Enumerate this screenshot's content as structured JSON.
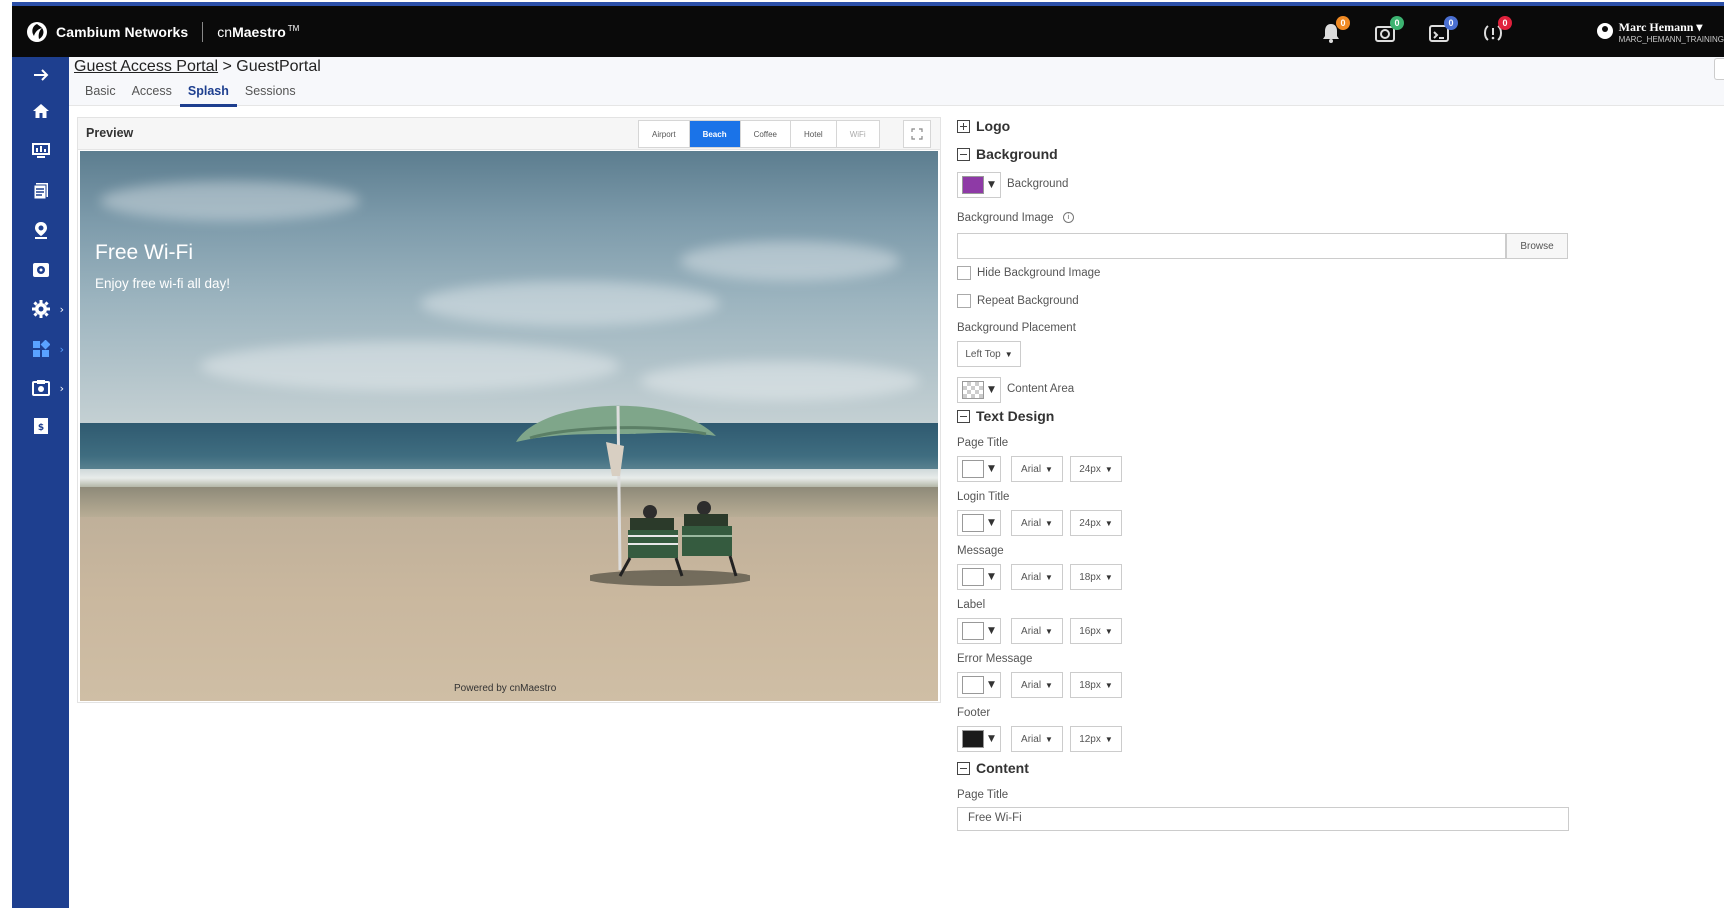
{
  "header": {
    "brand_name": "Cambium Networks",
    "product_prefix": "cn",
    "product_name": "Maestro",
    "product_mark": "TM",
    "notifications": [
      {
        "icon": "bell-icon",
        "count": "0",
        "color": "#f08a24"
      },
      {
        "icon": "device-alarm-icon",
        "count": "0",
        "color": "#3cb371"
      },
      {
        "icon": "event-icon",
        "count": "0",
        "color": "#4a6fd1"
      },
      {
        "icon": "alert-icon",
        "count": "0",
        "color": "#e0213c"
      }
    ],
    "user_name": "Marc Hemann ▾",
    "user_org": "MARC_HEMANN_TRAINING"
  },
  "sidebar": {
    "items": [
      {
        "icon": "arrow-right-icon"
      },
      {
        "icon": "home-icon"
      },
      {
        "icon": "monitor-icon"
      },
      {
        "icon": "reports-icon"
      },
      {
        "icon": "location-pin-icon"
      },
      {
        "icon": "onboard-icon"
      },
      {
        "icon": "gear-icon",
        "has_submenu": true
      },
      {
        "icon": "apps-icon",
        "has_submenu": true,
        "active": true
      },
      {
        "icon": "tools-icon",
        "has_submenu": true
      },
      {
        "icon": "document-icon"
      }
    ]
  },
  "breadcrumb": {
    "parent": "Guest Access Portal",
    "separator": " > ",
    "current": "GuestPortal"
  },
  "tabs": [
    {
      "label": "Basic",
      "active": false
    },
    {
      "label": "Access",
      "active": false
    },
    {
      "label": "Splash",
      "active": true
    },
    {
      "label": "Sessions",
      "active": false
    }
  ],
  "preview": {
    "title": "Preview",
    "themes": [
      {
        "label": "Airport",
        "active": false
      },
      {
        "label": "Beach",
        "active": true
      },
      {
        "label": "Coffee",
        "active": false
      },
      {
        "label": "Hotel",
        "active": false
      },
      {
        "label": "WiFi",
        "active": false
      }
    ],
    "page_title": "Free Wi-Fi",
    "message": "Enjoy free wi-fi all day!",
    "footer": "Powered by cnMaestro"
  },
  "settings": {
    "logo_section": "Logo",
    "background_section": "Background",
    "background_color": "#8e3aa6",
    "background_label": "Background",
    "background_image_label": "Background Image",
    "browse_label": "Browse",
    "hide_bg_label": "Hide Background Image",
    "repeat_bg_label": "Repeat Background",
    "placement_label": "Background Placement",
    "placement_value": "Left Top",
    "content_area_label": "Content Area",
    "text_design_section": "Text Design",
    "text_rows": [
      {
        "label": "Page Title",
        "color": "#ffffff",
        "font": "Arial",
        "size": "24px"
      },
      {
        "label": "Login Title",
        "color": "#ffffff",
        "font": "Arial",
        "size": "24px"
      },
      {
        "label": "Message",
        "color": "#ffffff",
        "font": "Arial",
        "size": "18px"
      },
      {
        "label": "Label",
        "color": "#ffffff",
        "font": "Arial",
        "size": "16px"
      },
      {
        "label": "Error Message",
        "color": "#ffffff",
        "font": "Arial",
        "size": "18px"
      },
      {
        "label": "Footer",
        "color": "#1a1a1a",
        "font": "Arial",
        "size": "12px"
      }
    ],
    "content_section": "Content",
    "content_page_title_label": "Page Title",
    "content_page_title_value": "Free Wi-Fi"
  }
}
